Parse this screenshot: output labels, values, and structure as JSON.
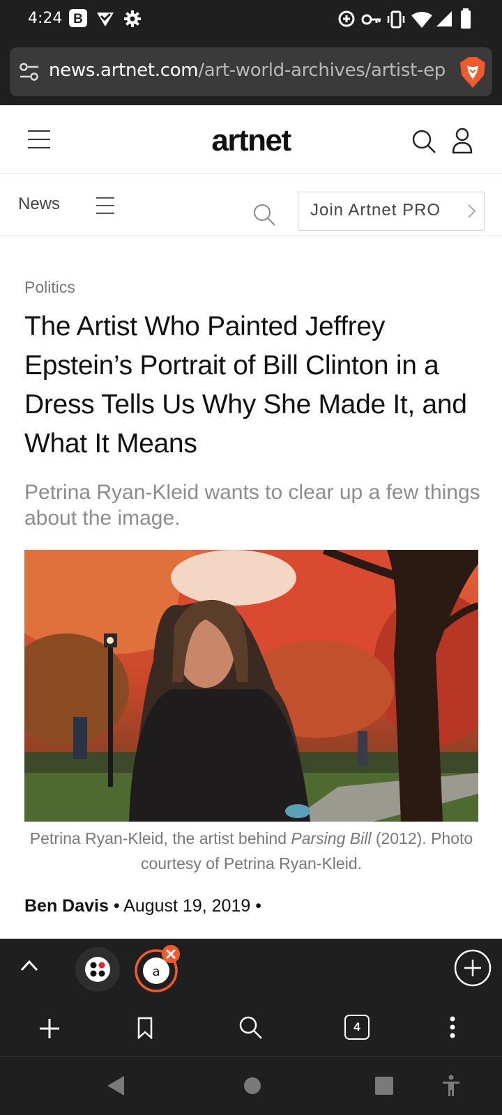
{
  "status_bar": {
    "time": "4:24",
    "app_badge": "B"
  },
  "browser": {
    "url_domain": "news.artnet.com",
    "url_path": "/art-world-archives/artist-epste",
    "tab_count": "4",
    "active_tab_letter": "a"
  },
  "site": {
    "logo": "artnet",
    "section": "News",
    "join_button": "Join Artnet PRO"
  },
  "article": {
    "category": "Politics",
    "headline": "The Artist Who Painted Jeffrey Epstein’s Portrait of Bill Clinton in a Dress Tells Us Why She Made It, and What It Means",
    "dek": "Petrina Ryan-Kleid wants to clear up a few things about the image.",
    "caption_before": "Petrina Ryan-Kleid, the artist behind ",
    "caption_title": "Parsing Bill",
    "caption_after": " (2012). Photo courtesy of Petrina Ryan-Kleid.",
    "author": "Ben Davis",
    "date": "August 19, 2019"
  },
  "colors": {
    "accent": "#f15a2b",
    "chrome_bg": "#1f1f1f"
  }
}
